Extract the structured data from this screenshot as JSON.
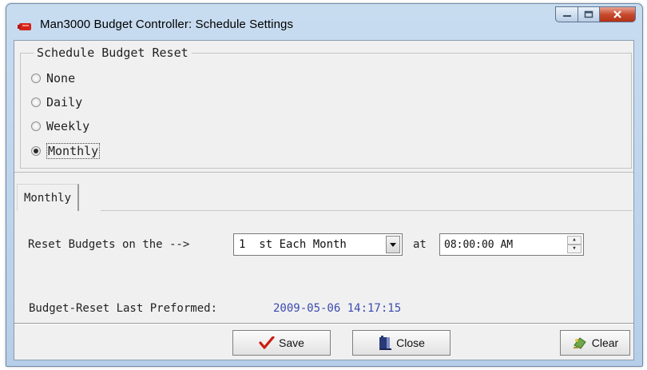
{
  "window": {
    "title": "Man3000 Budget Controller: Schedule Settings"
  },
  "schedule": {
    "legend": "Schedule Budget Reset",
    "options": [
      {
        "label": "None",
        "selected": false
      },
      {
        "label": "Daily",
        "selected": false
      },
      {
        "label": "Weekly",
        "selected": false
      },
      {
        "label": "Monthly",
        "selected": true
      }
    ]
  },
  "tab": {
    "label": "Monthly"
  },
  "reset": {
    "label": "Reset Budgets on the -->",
    "day_value": "1  st Each Month",
    "at_label": "at",
    "time_value": "08:00:00 AM"
  },
  "last": {
    "label": "Budget-Reset Last Preformed:",
    "value": "2009-05-06 14:17:15"
  },
  "buttons": {
    "save": "Save",
    "close": "Close",
    "clear": "Clear"
  },
  "colors": {
    "accent_value": "#3a4ab0",
    "save_check": "#cc1b10"
  },
  "icons": {
    "app": "red-app-icon",
    "save": "red-checkmark-icon",
    "close": "door-exit-icon",
    "clear": "eraser-clear-icon"
  }
}
